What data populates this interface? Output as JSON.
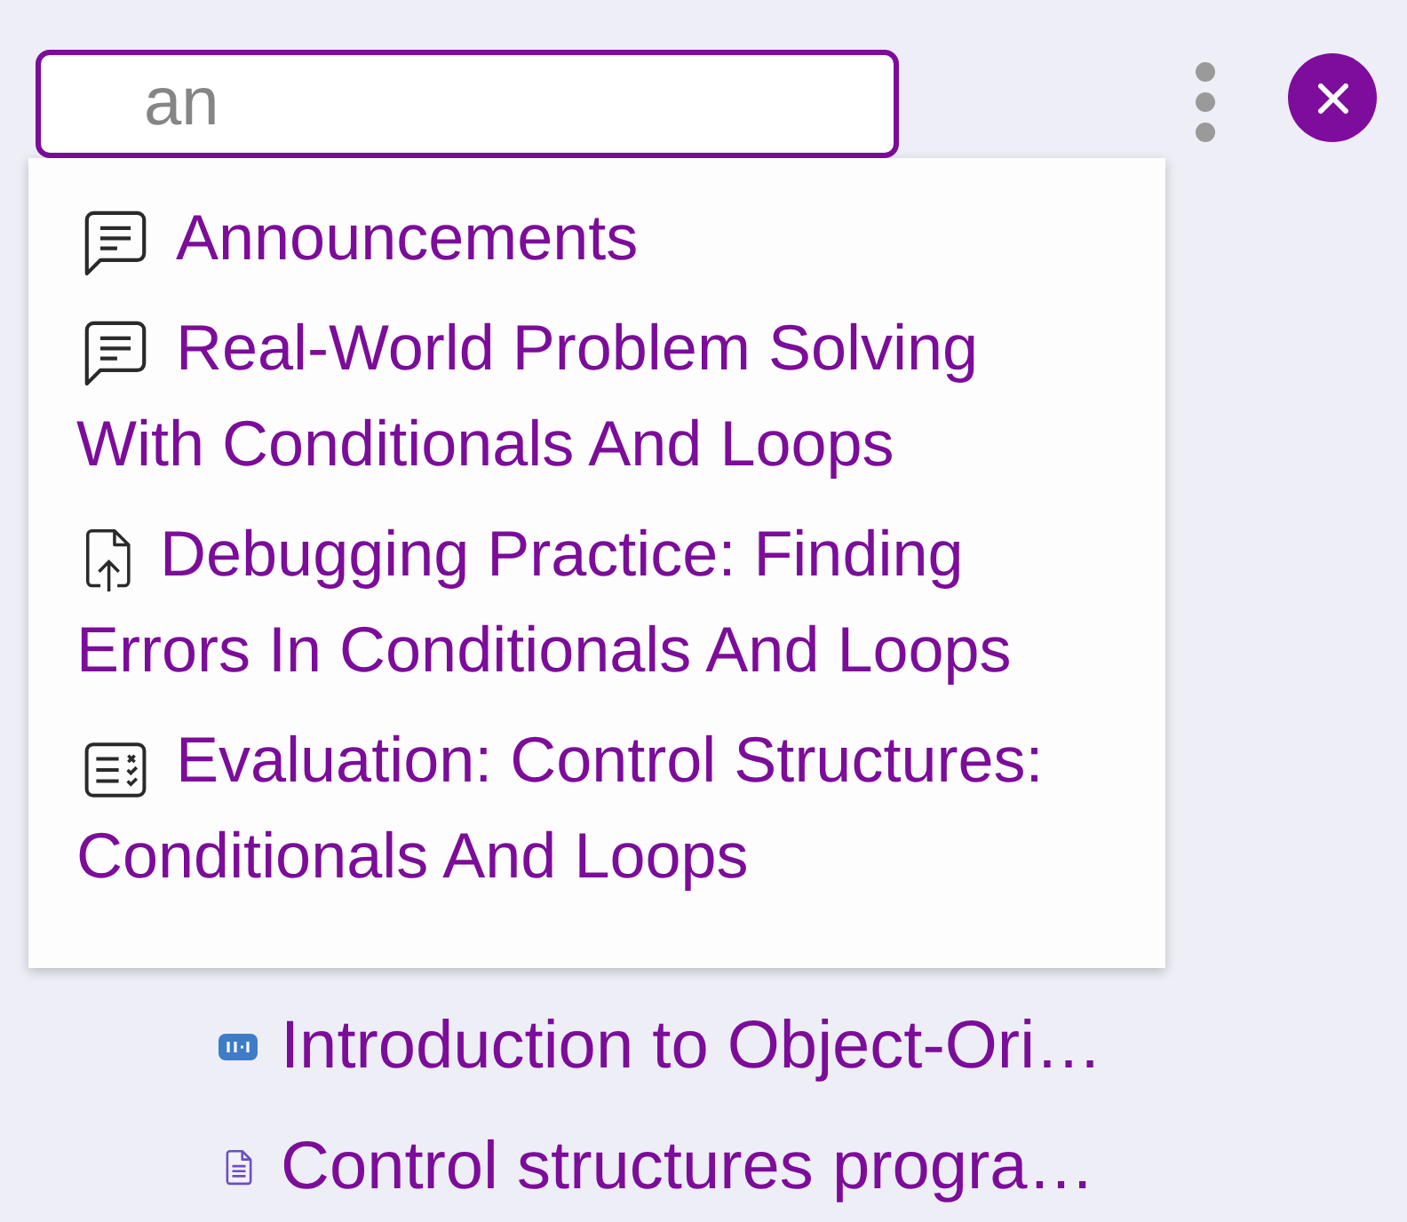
{
  "search": {
    "value": "an"
  },
  "results": [
    {
      "kind": "forum",
      "title": "Announcements"
    },
    {
      "kind": "forum",
      "title": "Real-World Problem Solving With Conditionals And Loops"
    },
    {
      "kind": "assignment",
      "title": "Debugging Practice: Finding Errors In Conditionals And Loops"
    },
    {
      "kind": "quiz",
      "title": "Evaluation: Control Structures: Conditionals And Loops"
    }
  ],
  "course_index": [
    {
      "kind": "interactive",
      "title": "Introduction to Object-Ori…"
    },
    {
      "kind": "document",
      "title": "Control structures progra…"
    }
  ]
}
